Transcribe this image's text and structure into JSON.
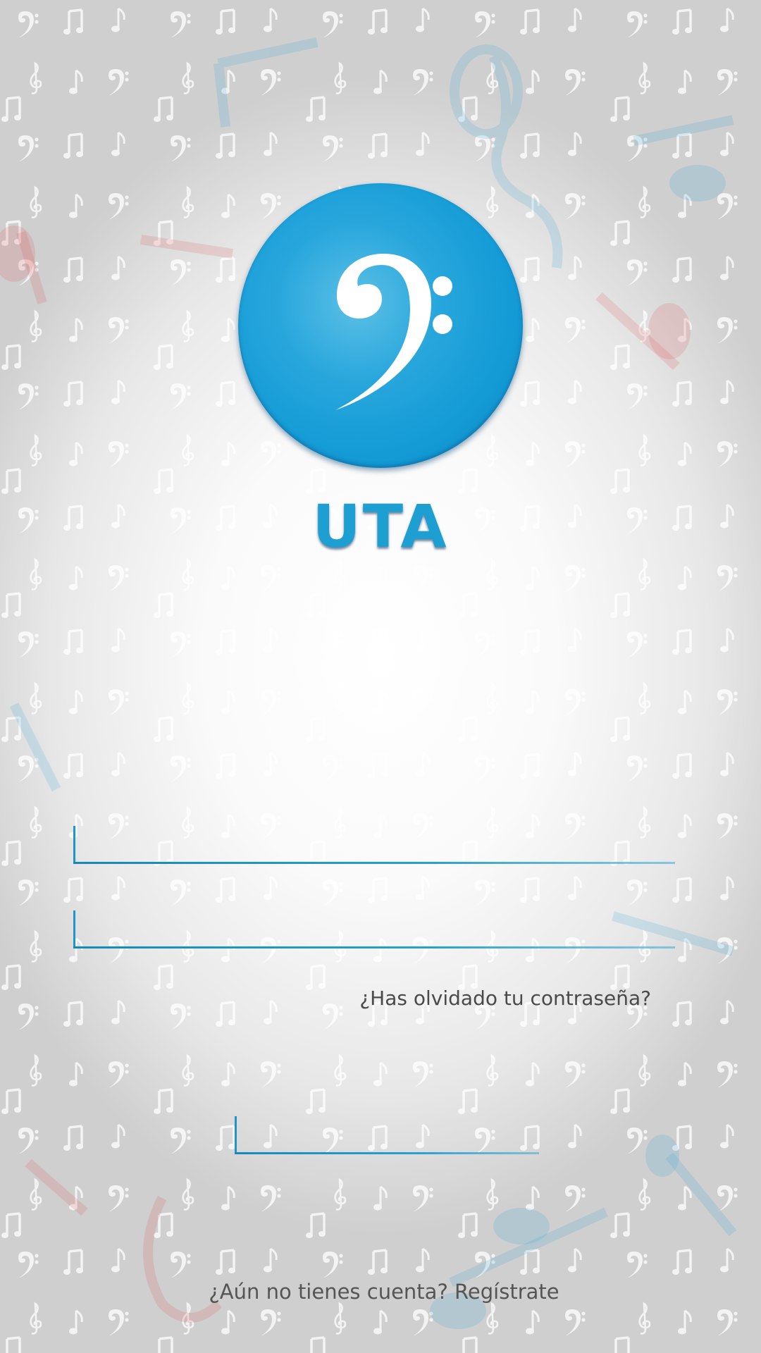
{
  "app": {
    "name": "UTA"
  },
  "logo": {
    "icon": "bass-clef-icon",
    "circle_color": "#1ba2d9",
    "glyph_color": "#ffffff"
  },
  "form": {
    "username": {
      "value": "",
      "placeholder": ""
    },
    "password": {
      "value": "",
      "placeholder": ""
    },
    "login": {
      "value": "",
      "placeholder": ""
    },
    "accent_color": "#1e96c8",
    "forgot_password": "¿Has olvidado tu contraseña?"
  },
  "footer": {
    "register": "¿Aún no tienes cuenta? Regístrate"
  },
  "background": {
    "pattern": "music-notes-pattern",
    "base_color": "#e6e6e6",
    "center_color": "#ffffff"
  }
}
